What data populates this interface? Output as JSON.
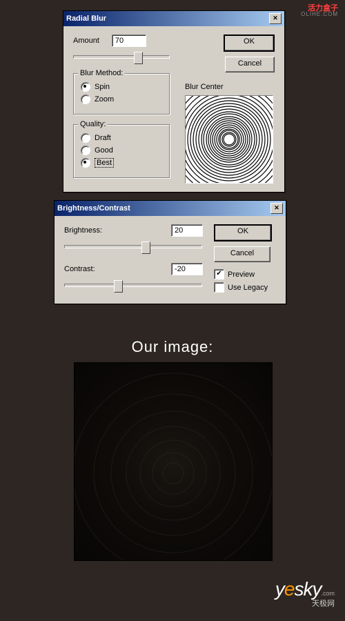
{
  "watermark_top": "活力盒子",
  "watermark_top2": "OLIHE.COM",
  "dialog1": {
    "title": "Radial Blur",
    "amount_label": "Amount",
    "amount_value": "70",
    "ok": "OK",
    "cancel": "Cancel",
    "method_title": "Blur Method:",
    "spin": "Spin",
    "zoom": "Zoom",
    "quality_title": "Quality:",
    "draft": "Draft",
    "good": "Good",
    "best": "Best",
    "center_label": "Blur Center"
  },
  "dialog2": {
    "title": "Brightness/Contrast",
    "brightness_label": "Brightness:",
    "brightness_value": "20",
    "contrast_label": "Contrast:",
    "contrast_value": "-20",
    "ok": "OK",
    "cancel": "Cancel",
    "preview": "Preview",
    "legacy": "Use Legacy"
  },
  "our_image": "Our image:",
  "yesky": {
    "y": "y",
    "e": "e",
    "rest": "sky",
    "com": ".com",
    "cn": "天极网"
  }
}
